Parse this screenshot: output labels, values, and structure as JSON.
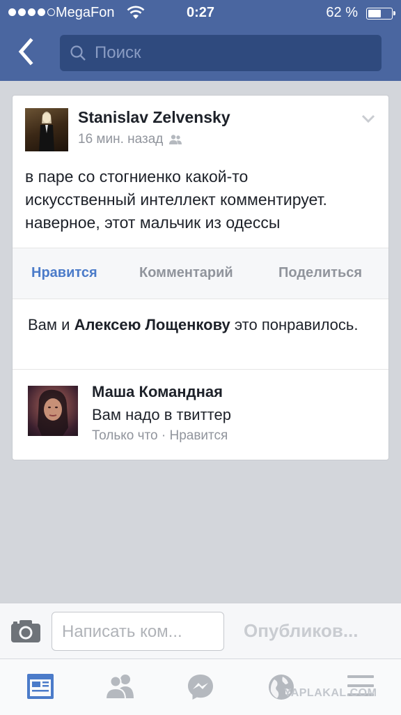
{
  "status_bar": {
    "carrier": "MegaFon",
    "time": "0:27",
    "battery_percent": "62 %",
    "battery_level": 0.62,
    "signal_bars_filled": 4,
    "signal_bars_total": 5
  },
  "nav": {
    "search_placeholder": "Поиск"
  },
  "post": {
    "author": "Stanislav Zelvensky",
    "time_ago": "16 мин. назад",
    "text_lines": [
      "в паре со стогниенко какой-то",
      "искусственный интеллект комментирует.",
      "наверное, этот мальчик из одессы"
    ]
  },
  "actions": {
    "like": "Нравится",
    "comment": "Комментарий",
    "share": "Поделиться"
  },
  "likes": {
    "prefix": "Вам и ",
    "name": "Алексею Лощенкову",
    "suffix": " это понравилось."
  },
  "comment": {
    "author": "Маша Командная",
    "text": "Вам надо в твиттер",
    "time": "Только что",
    "separator": " · ",
    "like_label": "Нравится"
  },
  "composer": {
    "placeholder": "Написать ком...",
    "publish_label": "Опубликов..."
  },
  "watermark": "YAPLAKAL.COM",
  "colors": {
    "header_bg": "#4a66a0",
    "search_bg": "#2f4a7e",
    "like_active": "#4b7bc9",
    "tab_active": "#4b7bc9",
    "tab_inactive": "#b5b9bf"
  }
}
